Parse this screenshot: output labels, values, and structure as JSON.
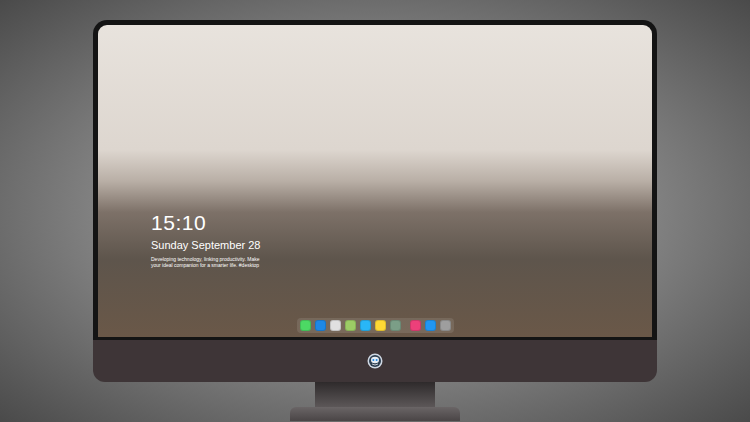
{
  "desktop": {
    "clock": {
      "time": "15:10",
      "date": "Sunday September 28",
      "caption": [
        "Developing technology, linking productivity. Make",
        "your ideal companion for a smarter life. #desktop"
      ]
    },
    "dock": {
      "groups": [
        {
          "apps": [
            {
              "color": "#4cd964"
            },
            {
              "color": "#1e88e5"
            },
            {
              "color": "#e0e0e0"
            },
            {
              "color": "#9ccc65"
            },
            {
              "color": "#29b6f6"
            },
            {
              "color": "#fdd835"
            },
            {
              "color": "#7b9e87"
            }
          ]
        },
        {
          "apps": [
            {
              "color": "#ec407a"
            },
            {
              "color": "#2196f3"
            },
            {
              "color": "#9e9e9e"
            }
          ]
        }
      ]
    }
  }
}
